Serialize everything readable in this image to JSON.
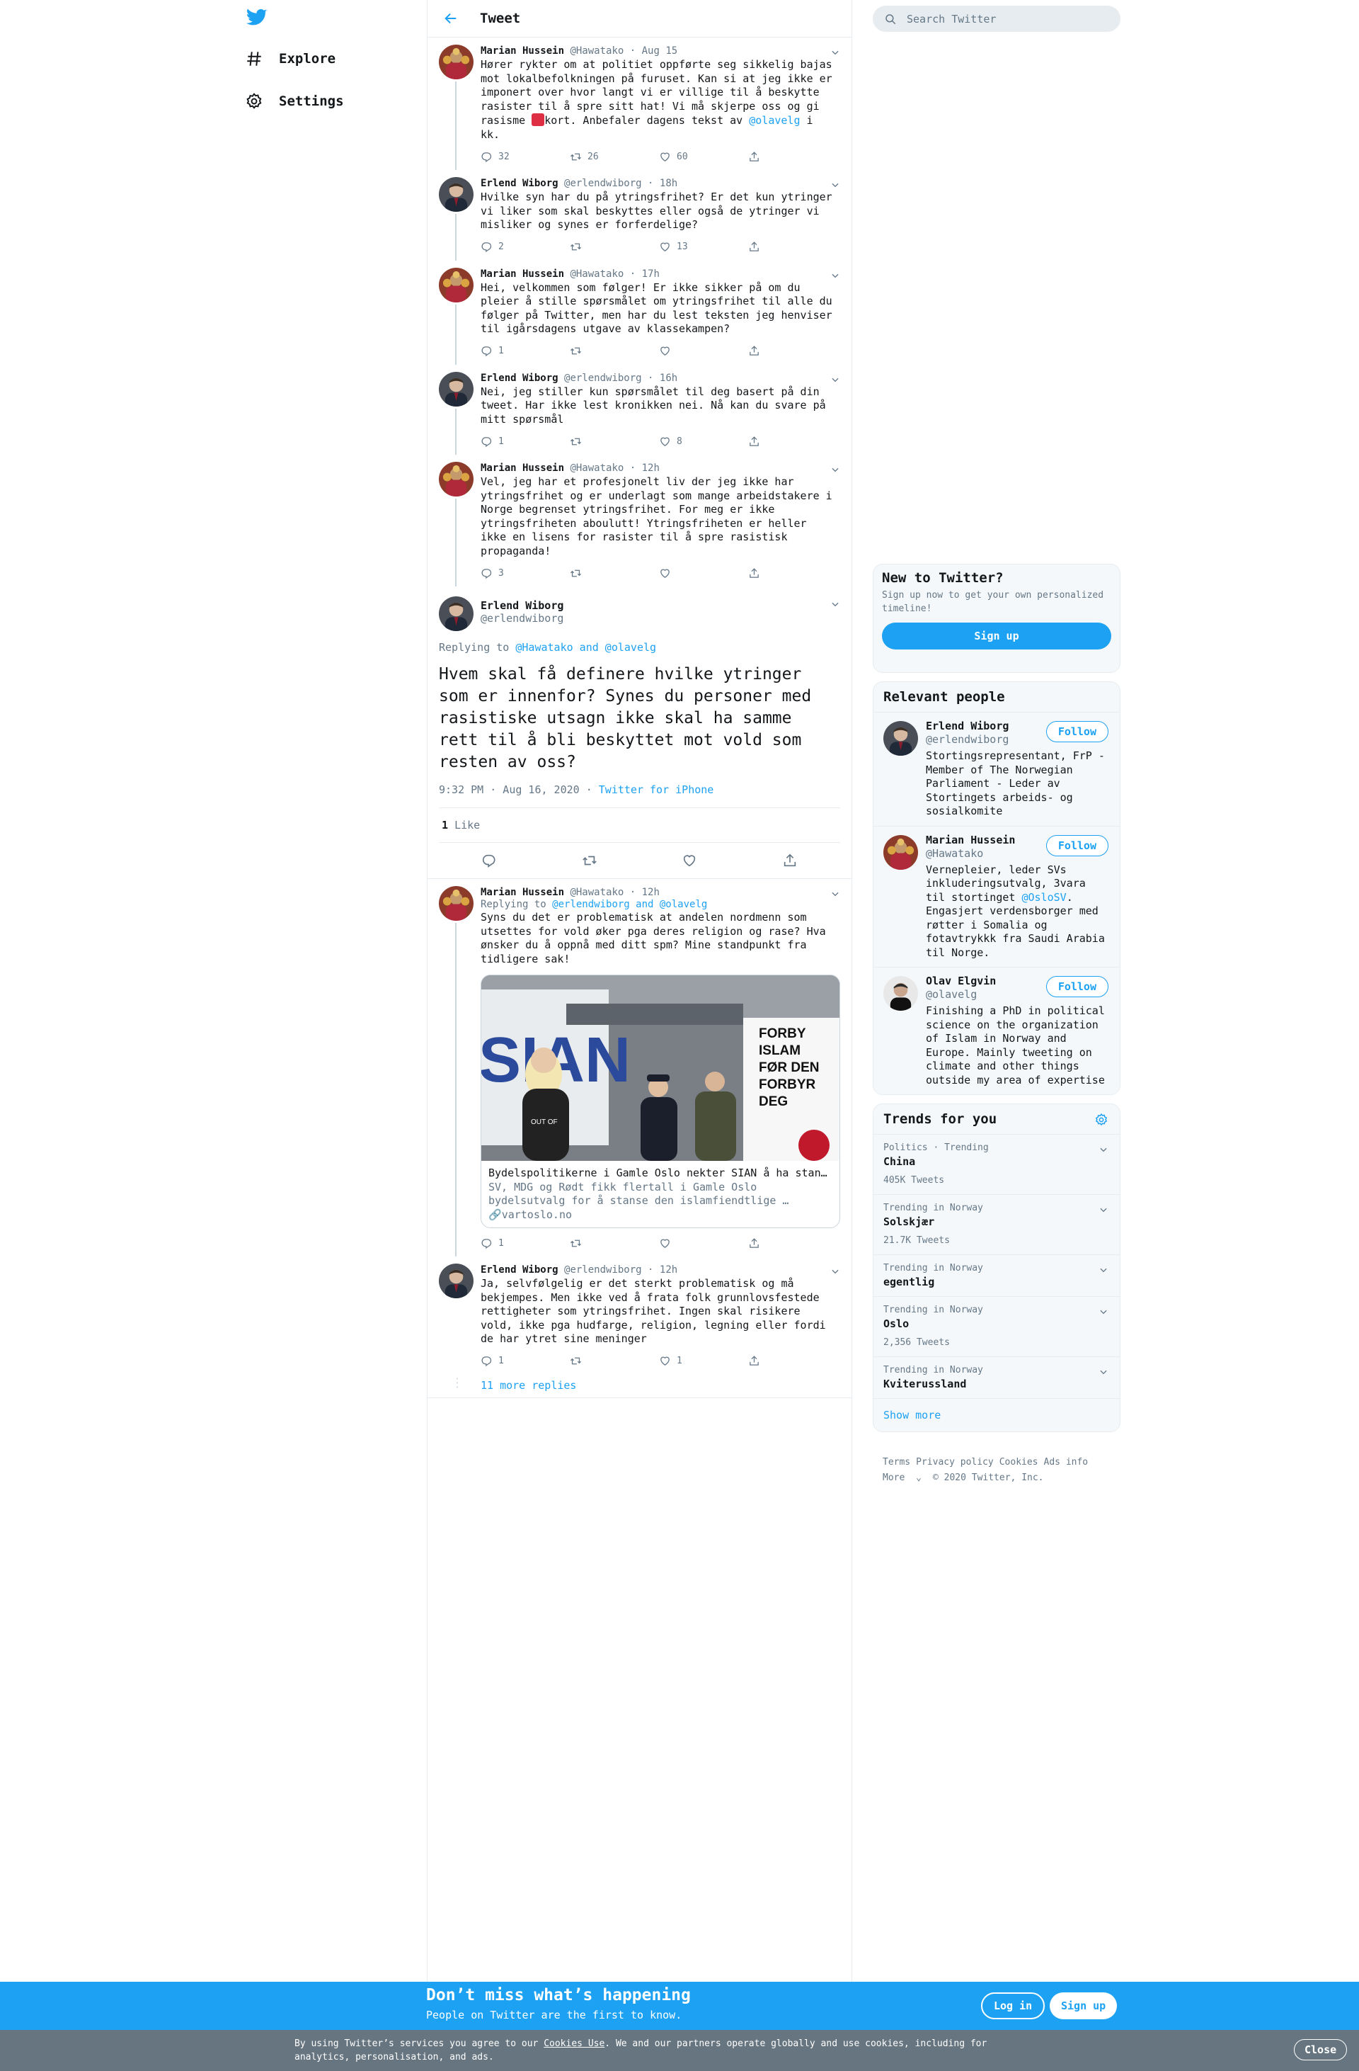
{
  "nav": {
    "logo_icon": "twitter-bird-icon",
    "explore_label": "Explore",
    "settings_label": "Settings"
  },
  "header": {
    "title": "Tweet",
    "back_icon": "back-arrow-icon"
  },
  "tweets": [
    {
      "name": "Marian Hussein",
      "handle": "@Hawatako",
      "sep": "·",
      "time": "Aug 15",
      "text_before": "Hører rykter om at politiet oppførte seg sikkelig bajas mot lokalbefolkningen på furuset. Kan si at jeg ikke er imponert over hvor langt vi er villige til å beskytte rasister til å spre sitt hat! Vi må skjerpe oss og gi rasisme ",
      "text_after": "kort. Anbefaler dagens tekst av ",
      "mention": "@olavelg",
      "text_end": " i kk.",
      "replies": "32",
      "retweets": "26",
      "likes": "60"
    },
    {
      "name": "Erlend Wiborg",
      "handle": "@erlendwiborg",
      "sep": "·",
      "time": "18h",
      "text": "Hvilke syn har du på ytringsfrihet? Er det kun ytringer vi liker som skal beskyttes eller også de ytringer vi misliker og synes er forferdelige?",
      "replies": "2",
      "retweets": "",
      "likes": "13"
    },
    {
      "name": "Marian Hussein",
      "handle": "@Hawatako",
      "sep": "·",
      "time": "17h",
      "text": "Hei, velkommen som følger! Er ikke sikker på om du pleier å stille spørsmålet om ytringsfrihet til alle du følger på Twitter, men har du lest teksten jeg henviser til igårsdagens utgave av klassekampen?",
      "replies": "1",
      "retweets": "",
      "likes": ""
    },
    {
      "name": "Erlend Wiborg",
      "handle": "@erlendwiborg",
      "sep": "·",
      "time": "16h",
      "text": "Nei, jeg stiller kun spørsmålet til deg basert på din tweet. Har ikke lest kronikken nei. Nå kan du svare på mitt spørsmål",
      "replies": "1",
      "retweets": "",
      "likes": "8"
    },
    {
      "name": "Marian Hussein",
      "handle": "@Hawatako",
      "sep": "·",
      "time": "12h",
      "text": "Vel, jeg har et profesjonelt liv der jeg ikke har ytringsfrihet og er underlagt som mange arbeidstakere i Norge begrenset ytringsfrihet. For meg er ikke ytringsfriheten aboulutt! Ytringsfriheten er heller ikke en lisens for rasister til å spre rasistisk propaganda!",
      "replies": "3",
      "retweets": "",
      "likes": ""
    }
  ],
  "focal": {
    "name": "Erlend Wiborg",
    "handle": "@erlendwiborg",
    "replying_prefix": "Replying to ",
    "replying_to": "@Hawatako and @olavelg",
    "text": "Hvem skal få definere hvilke ytringer som er innenfor? Synes du personer med rasistiske utsagn ikke skal ha samme rett til å bli beskyttet mot vold som resten av oss?",
    "time": "9:32 PM · Aug 16, 2020",
    "sep": "·",
    "source": "Twitter for iPhone",
    "likes_count": "1",
    "likes_label": "Like"
  },
  "replies": [
    {
      "name": "Marian Hussein",
      "handle": "@Hawatako",
      "sep": "·",
      "time": "12h",
      "replying_prefix": "Replying to ",
      "replying_to": "@erlendwiborg and @olavelg",
      "text": "Syns du det er problematisk at andelen nordmenn som utsettes for vold øker pga deres religion og rase? Hva ønsker du å oppnå med ditt spm? Mine standpunkt fra tidligere sak!",
      "card": {
        "title": "Bydelspolitikerne i Gamle Oslo nekter SIAN å ha stand…",
        "desc": "SV, MDG og Rødt fikk flertall i Gamle Oslo bydelsutvalg for å stanse den islamfiendtlige …",
        "domain": "vartoslo.no",
        "sign_lines": [
          "FORBY",
          "ISLAM",
          "FØR DEN",
          "FORBYR",
          "DEG"
        ],
        "shirt_text": "OUT OF",
        "banner_text": "SIAN"
      },
      "replies": "1",
      "retweets": "",
      "likes": ""
    },
    {
      "name": "Erlend Wiborg",
      "handle": "@erlendwiborg",
      "sep": "·",
      "time": "12h",
      "text": "Ja, selvfølgelig er det sterkt problematisk og må bekjempes. Men ikke ved å frata folk grunnlovsfestede rettigheter som ytringsfrihet. Ingen skal risikere vold, ikke pga hudfarge, religion, legning eller fordi de har ytret sine meninger",
      "replies": "1",
      "retweets": "",
      "likes": "1"
    }
  ],
  "more_replies": "11 more replies",
  "search": {
    "placeholder": "Search Twitter"
  },
  "new_to_twitter": {
    "title": "New to Twitter?",
    "subtitle": "Sign up now to get your own personalized timeline!",
    "button": "Sign up"
  },
  "relevant": {
    "title": "Relevant people",
    "follow_label": "Follow",
    "people": [
      {
        "name": "Erlend Wiborg",
        "handle": "@erlendwiborg",
        "bio": "Stortingsrepresentant, FrP - Member of The Norwegian Parliament - Leder av Stortingets arbeids- og sosialkomite"
      },
      {
        "name": "Marian Hussein",
        "handle": "@Hawatako",
        "bio_before": "Vernepleier, leder SVs inkluderingsutvalg, 3vara til stortinget ",
        "bio_mention": "@OsloSV",
        "bio_after": ". Engasjert verdensborger med røtter i Somalia og fotavtrykkk fra Saudi Arabia til Norge."
      },
      {
        "name": "Olav Elgvin",
        "handle": "@olavelg",
        "bio": "Finishing a PhD in political science on the organization of Islam in Norway and Europe. Mainly tweeting on climate and other things outside my area of expertise"
      }
    ]
  },
  "trends": {
    "title": "Trends for you",
    "settings_icon": "gear-icon",
    "items": [
      {
        "context": "Politics · Trending",
        "name": "China",
        "count": "405K Tweets"
      },
      {
        "context": "Trending in Norway",
        "name": "Solskjær",
        "count": "21.7K Tweets"
      },
      {
        "context": "Trending in Norway",
        "name": "egentlig",
        "count": ""
      },
      {
        "context": "Trending in Norway",
        "name": "Oslo",
        "count": "2,356 Tweets"
      },
      {
        "context": "Trending in Norway",
        "name": "Kviterussland",
        "count": ""
      }
    ],
    "show_more": "Show more"
  },
  "footer": {
    "links": [
      "Terms",
      "Privacy policy",
      "Cookies",
      "Ads info"
    ],
    "more": "More",
    "copyright": "© 2020 Twitter, Inc."
  },
  "bottom_bar": {
    "title": "Don’t miss what’s happening",
    "subtitle": "People on Twitter are the first to know.",
    "login": "Log in",
    "signup": "Sign up"
  },
  "cookie": {
    "before": "By using Twitter’s services you agree to our ",
    "link": "Cookies Use",
    "after": ". We and our partners operate globally and use cookies, including for analytics, personalisation, and ads.",
    "close": "Close"
  },
  "colors": {
    "accent": "#1da1f2",
    "text": "#14171a",
    "muted": "#657786",
    "border": "#e6ecf0",
    "panel_bg": "#f5f8fa",
    "cookie_bg": "#66757f"
  }
}
